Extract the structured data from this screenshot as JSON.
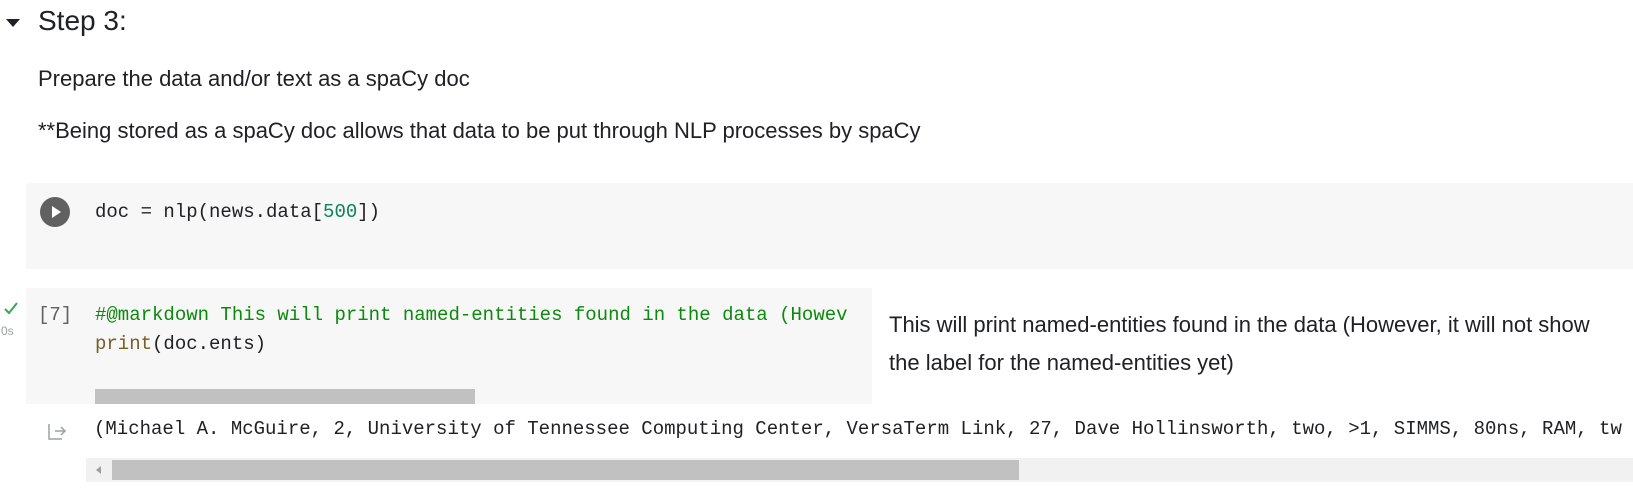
{
  "section": {
    "title": "Step 3:"
  },
  "markdown": {
    "line1": "Prepare the data and/or text as a spaCy doc",
    "line2": "**Being stored as a spaCy doc allows that data to be put through NLP processes by spaCy"
  },
  "cell1": {
    "code_prefix": "doc = nlp(news.data[",
    "code_number": "500",
    "code_suffix": "])"
  },
  "cell2": {
    "exec_count": "[7]",
    "exec_time": "0s",
    "line1": "#@markdown This will print named-entities found in the data (Howev",
    "line2_builtin": "print",
    "line2_rest": "(doc.ents)",
    "form_text": "This will print named-entities found in the data (However, it will not show the label for the named-entities yet)"
  },
  "output": {
    "text": "(Michael A. McGuire, 2, University of Tennessee Computing Center, VersaTerm Link, 27, Dave Hollinsworth, two, >1, SIMMS, 80ns, RAM, tw"
  },
  "icons": {
    "collapse": "triangle-down-icon",
    "run": "play-icon",
    "status": "check-icon",
    "output": "output-arrow-icon",
    "scroll": "scroll-left-arrow-icon"
  },
  "colors": {
    "comment": "#0b8a0b",
    "number": "#098658",
    "builtin": "#795e26",
    "check": "#34a853",
    "cell_bg": "#f7f7f7"
  }
}
